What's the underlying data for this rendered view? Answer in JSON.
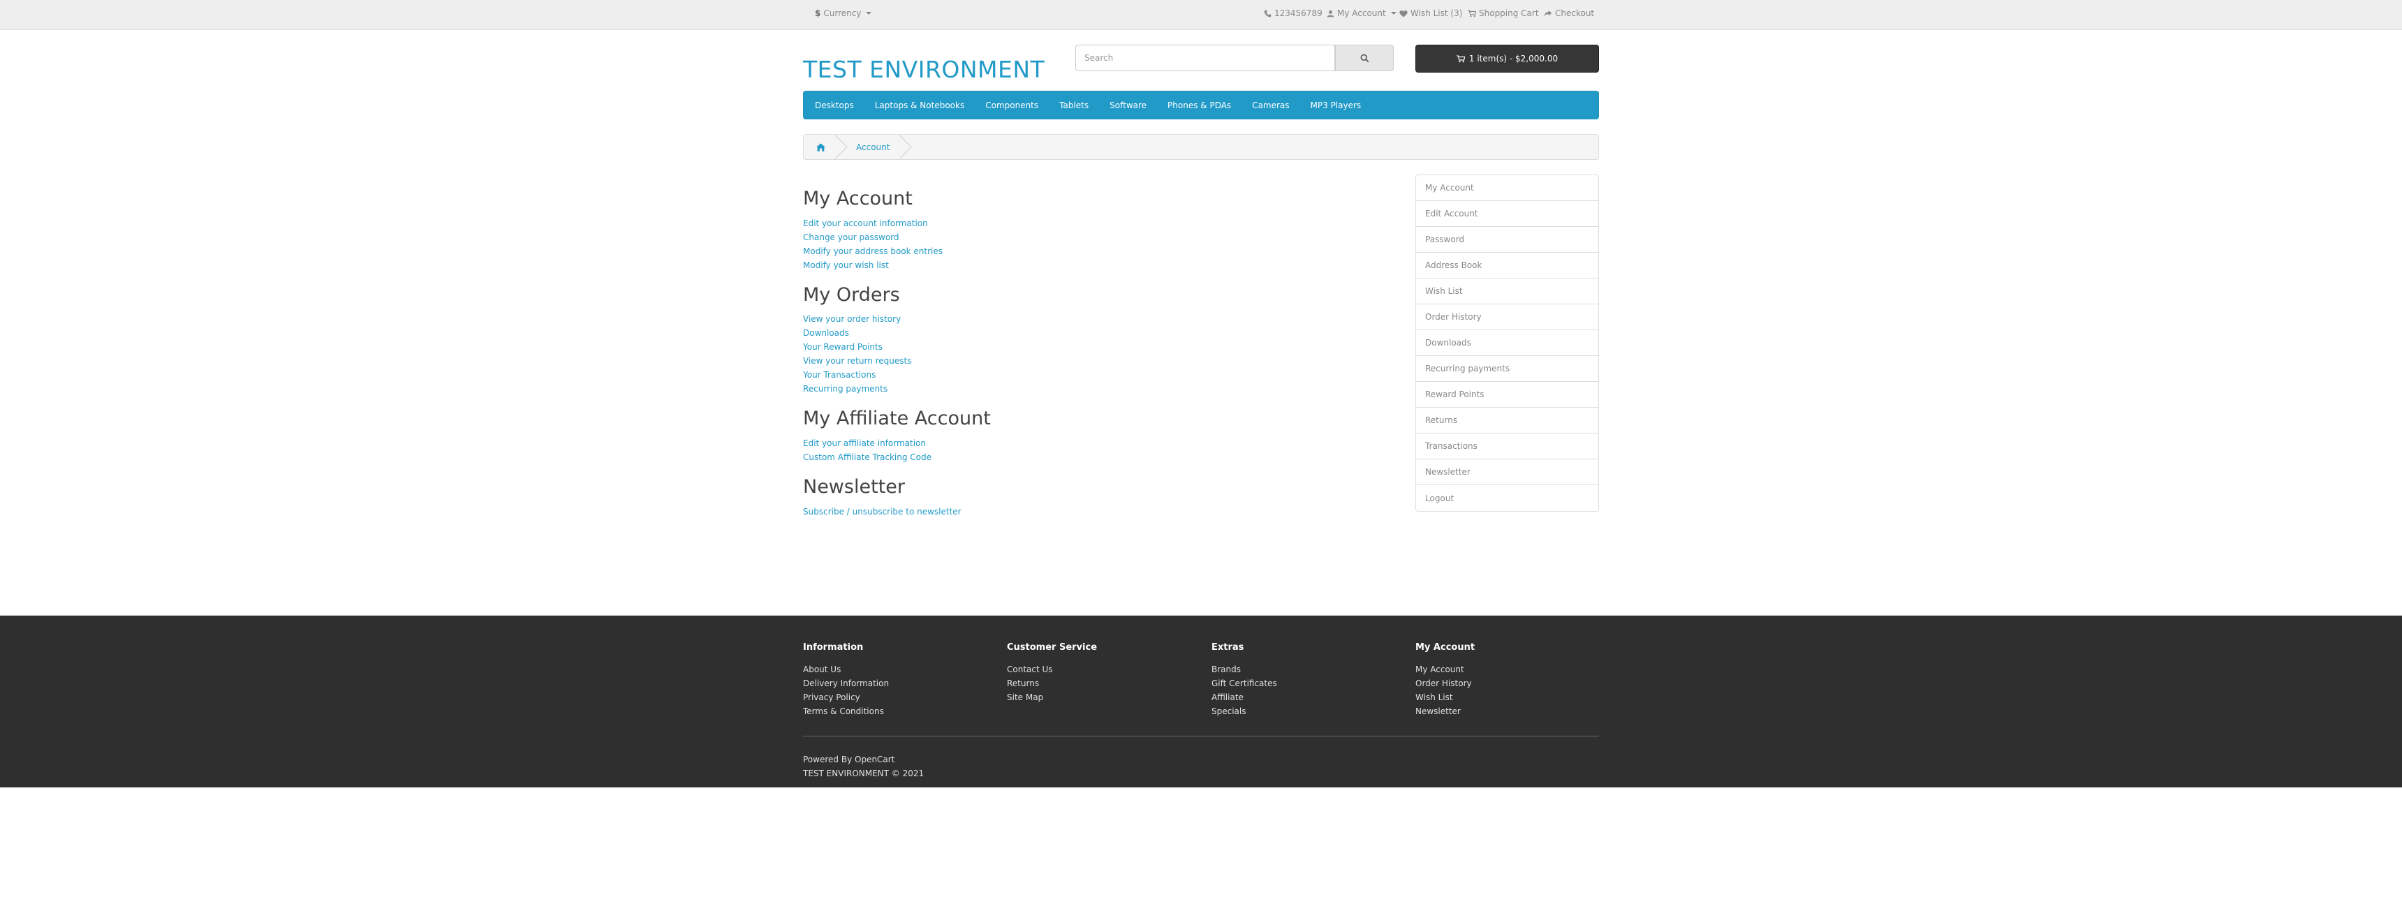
{
  "topbar": {
    "currency_symbol": "$",
    "currency_label": "Currency",
    "phone": "123456789",
    "my_account": "My Account",
    "wishlist": "Wish List (3)",
    "shopping_cart": "Shopping Cart",
    "checkout": "Checkout"
  },
  "header": {
    "logo": "TEST ENVIRONMENT",
    "search_placeholder": "Search",
    "cart_button": "1 item(s) - $2,000.00"
  },
  "menu": [
    "Desktops",
    "Laptops & Notebooks",
    "Components",
    "Tablets",
    "Software",
    "Phones & PDAs",
    "Cameras",
    "MP3 Players"
  ],
  "breadcrumb": {
    "current": "Account"
  },
  "sections": {
    "my_account": {
      "title": "My Account",
      "links": [
        "Edit your account information",
        "Change your password",
        "Modify your address book entries",
        "Modify your wish list"
      ]
    },
    "my_orders": {
      "title": "My Orders",
      "links": [
        "View your order history",
        "Downloads",
        "Your Reward Points",
        "View your return requests",
        "Your Transactions",
        "Recurring payments"
      ]
    },
    "affiliate": {
      "title": "My Affiliate Account",
      "links": [
        "Edit your affiliate information",
        "Custom Affiliate Tracking Code"
      ]
    },
    "newsletter": {
      "title": "Newsletter",
      "links": [
        "Subscribe / unsubscribe to newsletter"
      ]
    }
  },
  "sidebar": [
    "My Account",
    "Edit Account",
    "Password",
    "Address Book",
    "Wish List",
    "Order History",
    "Downloads",
    "Recurring payments",
    "Reward Points",
    "Returns",
    "Transactions",
    "Newsletter",
    "Logout"
  ],
  "footer": {
    "information": {
      "title": "Information",
      "links": [
        "About Us",
        "Delivery Information",
        "Privacy Policy",
        "Terms & Conditions"
      ]
    },
    "customer_service": {
      "title": "Customer Service",
      "links": [
        "Contact Us",
        "Returns",
        "Site Map"
      ]
    },
    "extras": {
      "title": "Extras",
      "links": [
        "Brands",
        "Gift Certificates",
        "Affiliate",
        "Specials"
      ]
    },
    "my_account": {
      "title": "My Account",
      "links": [
        "My Account",
        "Order History",
        "Wish List",
        "Newsletter"
      ]
    },
    "powered_prefix": "Powered By",
    "powered_name": "OpenCart",
    "copyright": "TEST ENVIRONMENT © 2021"
  },
  "colors": {
    "accent": "#229ac8",
    "footer_bg": "#2f2f2f",
    "topbar_bg": "#eeeeee"
  }
}
